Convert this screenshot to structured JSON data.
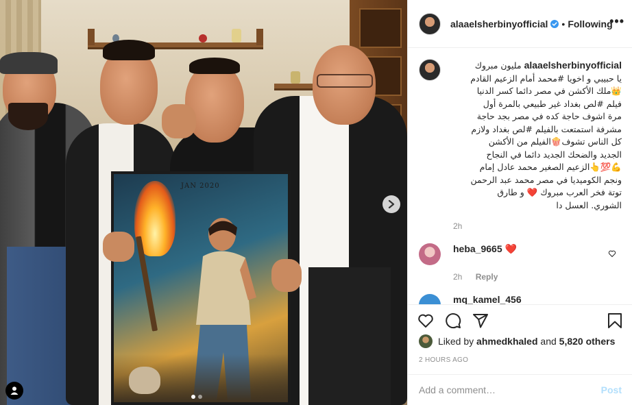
{
  "post": {
    "author": "alaaelsherbinyofficial",
    "follow_status": "Following",
    "more_label": "•••",
    "photo": {
      "poster_date": "JAN 2020",
      "carousel_total": 2,
      "carousel_index": 1
    },
    "caption": {
      "username": "alaaelsherbinyofficial",
      "lines": [
        "مليون مبروك",
        "يا حبيبي و اخويا #محمد أمام الزعيم القادم",
        "👑ملك الأكشن في مصر دائما كسر الدنيا",
        "فيلم #لص بغداد غير طبيعي بالمرة أول",
        "مرة اشوف حاجة كده في مصر بجد حاجة",
        "مشرفة استمتعت بالفيلم #لص بغداد ولازم",
        "كل الناس تشوف🍿الفيلم من الأكشن",
        "الجديد والضحك الجديد دائما في النجاح",
        "💪💯👆الزعيم الصغير محمد عادل إمام",
        "ونجم الكوميديا في مصر محمد عبد الرحمن",
        "توتة فخر العرب مبروك ❤️ و طارق",
        "الشوري. العسل دا"
      ],
      "time": "2h"
    },
    "comments": [
      {
        "username": "heba_9665",
        "text": "❤️",
        "time": "2h",
        "reply_label": "Reply"
      }
    ],
    "partial_comment": "mq_kamel_456",
    "likes": {
      "prefix": "Liked by",
      "user": "ahmedkhaled",
      "and": "and",
      "others": "5,820 others"
    },
    "posted": "2 HOURS AGO",
    "add_comment_placeholder": "Add a comment…",
    "post_label": "Post"
  },
  "colors": {
    "text": "#262626",
    "muted": "#8e8e8e",
    "border": "#efefef",
    "verified": "#3897f0",
    "post_disabled": "#b2dffc",
    "heart": "#ed4956"
  },
  "icons": [
    "verified-badge-icon",
    "more-icon",
    "next-arrow-icon",
    "user-tag-icon",
    "heart-icon",
    "comment-icon",
    "share-icon",
    "bookmark-icon",
    "like-comment-icon"
  ]
}
